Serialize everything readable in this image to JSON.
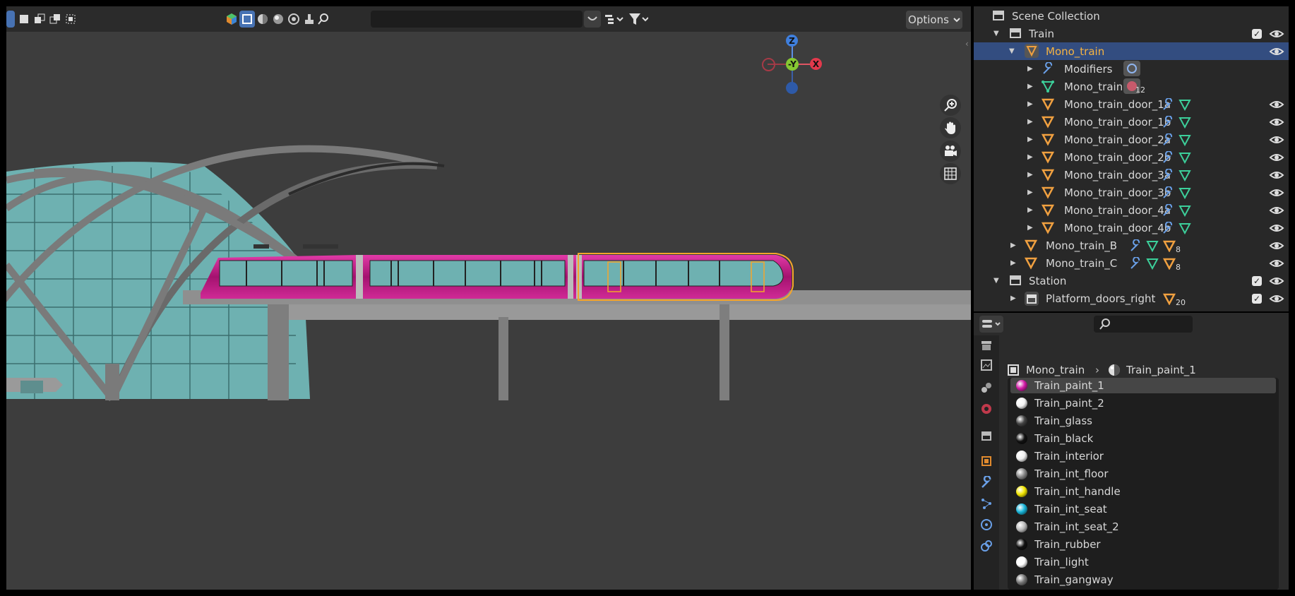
{
  "viewport": {
    "options_label": "Options",
    "gizmo": {
      "z": "Z",
      "y": "-Y",
      "x": "X"
    }
  },
  "outliner": {
    "rows": [
      {
        "label": "Scene Collection",
        "icon": "collection-icon"
      },
      {
        "label": "Train",
        "icon": "collection-icon"
      },
      {
        "label": "Mono_train",
        "icon": "mesh-object-icon"
      },
      {
        "label": "Modifiers",
        "icon": "wrench-icon"
      },
      {
        "label": "Mono_train",
        "icon": "mesh-data-icon",
        "badge": "12"
      },
      {
        "label": "Mono_train_door_1a"
      },
      {
        "label": "Mono_train_door_1b"
      },
      {
        "label": "Mono_train_door_2a"
      },
      {
        "label": "Mono_train_door_2b"
      },
      {
        "label": "Mono_train_door_3a"
      },
      {
        "label": "Mono_train_door_3b"
      },
      {
        "label": "Mono_train_door_4a"
      },
      {
        "label": "Mono_train_door_4b"
      },
      {
        "label": "Mono_train_B",
        "badge": "8"
      },
      {
        "label": "Mono_train_C",
        "badge": "8"
      },
      {
        "label": "Station",
        "icon": "collection-icon"
      },
      {
        "label": "Platform_doors_right",
        "badge": "20"
      }
    ]
  },
  "properties": {
    "breadcrumb": {
      "object": "Mono_train",
      "material": "Train_paint_1"
    },
    "materials": [
      {
        "label": "Train_paint_1",
        "color": "#d21aa6"
      },
      {
        "label": "Train_paint_2",
        "color": "#f2f2f2"
      },
      {
        "label": "Train_glass",
        "color": "#444444"
      },
      {
        "label": "Train_black",
        "color": "#111111"
      },
      {
        "label": "Train_interior",
        "color": "#eeeeee"
      },
      {
        "label": "Train_int_floor",
        "color": "#888888"
      },
      {
        "label": "Train_int_handle",
        "color": "#f2e600"
      },
      {
        "label": "Train_int_seat",
        "color": "#18b4d8"
      },
      {
        "label": "Train_int_seat_2",
        "color": "#bbbbbb"
      },
      {
        "label": "Train_rubber",
        "color": "#111111"
      },
      {
        "label": "Train_light",
        "color": "#ffffff"
      },
      {
        "label": "Train_gangway",
        "color": "#777777"
      }
    ]
  },
  "colors": {
    "accent_selection": "#4772b3",
    "outliner_selected_row": "#334d80",
    "active_object_text": "#f5b342",
    "train_paint": "#b3187f",
    "glass": "#6fb3b3"
  }
}
